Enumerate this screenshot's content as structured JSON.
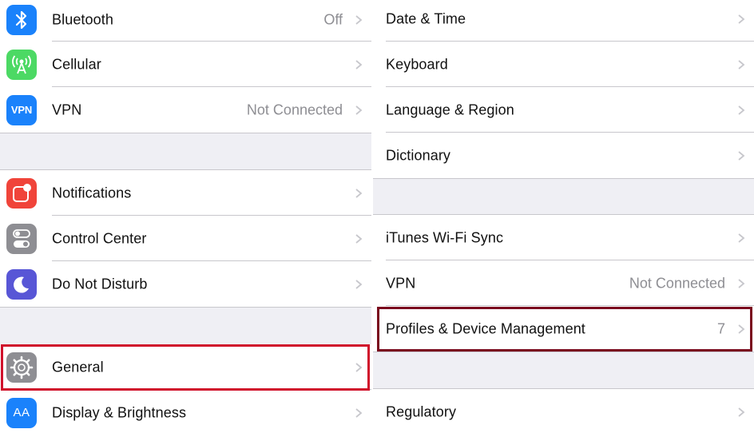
{
  "left_panel": {
    "items": [
      {
        "label": "Bluetooth",
        "detail": "Off",
        "icon": "bluetooth-icon",
        "color": "#1a82fb"
      },
      {
        "label": "Cellular",
        "detail": "",
        "icon": "cellular-antenna-icon",
        "color": "#4cd964"
      },
      {
        "label": "VPN",
        "detail": "Not Connected",
        "icon": "vpn-icon",
        "icon_text": "VPN",
        "color": "#1a82fb"
      },
      {
        "label": "Notifications",
        "detail": "",
        "icon": "notifications-icon",
        "color": "#f0443a"
      },
      {
        "label": "Control Center",
        "detail": "",
        "icon": "control-center-icon",
        "color": "#8e8e93"
      },
      {
        "label": "Do Not Disturb",
        "detail": "",
        "icon": "moon-icon",
        "color": "#5856d6"
      },
      {
        "label": "General",
        "detail": "",
        "icon": "gear-icon",
        "color": "#8e8e93"
      },
      {
        "label": "Display & Brightness",
        "detail": "",
        "icon": "display-brightness-icon",
        "icon_text": "AA",
        "color": "#1a82fb"
      }
    ]
  },
  "right_panel": {
    "items": [
      {
        "label": "Date & Time",
        "detail": ""
      },
      {
        "label": "Keyboard",
        "detail": ""
      },
      {
        "label": "Language & Region",
        "detail": ""
      },
      {
        "label": "Dictionary",
        "detail": ""
      },
      {
        "label": "iTunes Wi-Fi Sync",
        "detail": ""
      },
      {
        "label": "VPN",
        "detail": "Not Connected"
      },
      {
        "label": "Profiles & Device Management",
        "detail": "7"
      },
      {
        "label": "Regulatory",
        "detail": ""
      }
    ]
  },
  "colors": {
    "highlight_general": "#d0112b",
    "highlight_profiles": "#7a0a1e",
    "background": "#efeff4",
    "chevron": "#c7c7cc"
  }
}
